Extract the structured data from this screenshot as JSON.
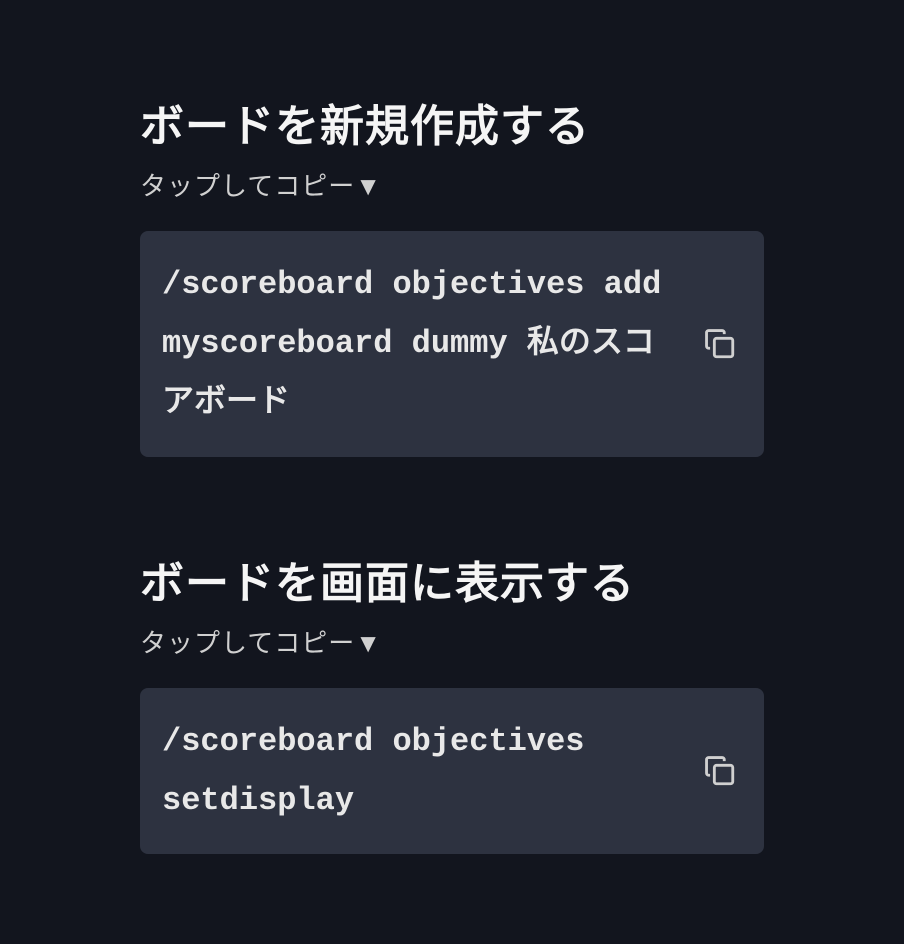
{
  "sections": [
    {
      "title": "ボードを新規作成する",
      "subtitle": "タップしてコピー▼",
      "code": "/scoreboard objectives add myscoreboard dummy 私のスコアボード"
    },
    {
      "title": "ボードを画面に表示する",
      "subtitle": "タップしてコピー▼",
      "code": "/scoreboard objectives setdisplay"
    }
  ]
}
